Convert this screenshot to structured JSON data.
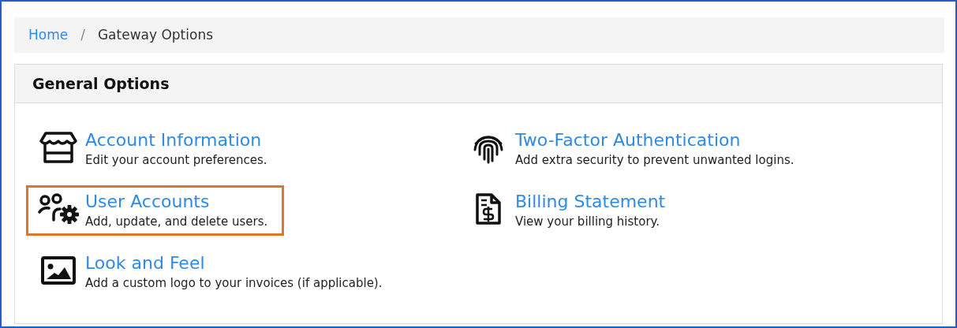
{
  "breadcrumb": [
    {
      "label": "Home",
      "kind": "link"
    },
    {
      "label": "/",
      "kind": "separator"
    },
    {
      "label": "Gateway Options",
      "kind": "current"
    }
  ],
  "panel": {
    "title": "General Options",
    "options": [
      {
        "title": "Account Information",
        "description": "Edit your account preferences.",
        "highlighted": false
      },
      {
        "title": "Two-Factor Authentication",
        "description": "Add extra security to prevent unwanted logins.",
        "highlighted": false
      },
      {
        "title": "User Accounts",
        "description": "Add, update, and delete users.",
        "highlighted": true
      },
      {
        "title": "Billing Statement",
        "description": "View your billing history.",
        "highlighted": false
      },
      {
        "title": "Look and Feel",
        "description": "Add a custom logo to your invoices (if applicable).",
        "highlighted": false
      }
    ]
  }
}
